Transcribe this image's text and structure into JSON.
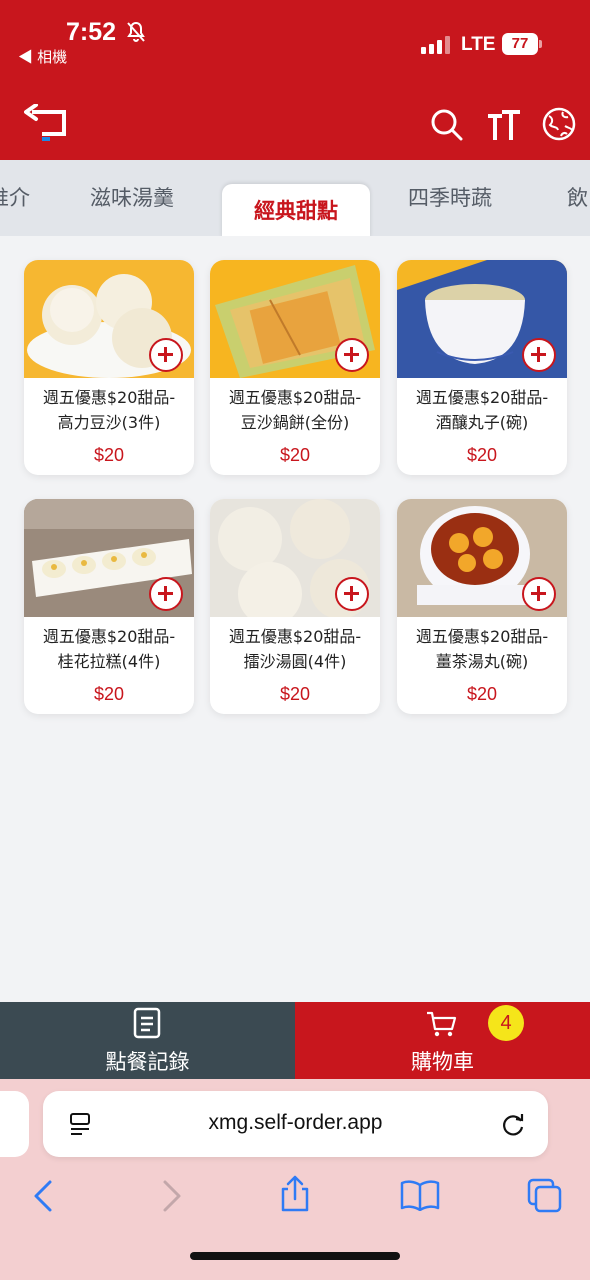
{
  "status": {
    "time": "7:52",
    "back_app": "◀ 相機",
    "network": "LTE",
    "battery": "77"
  },
  "tabs": [
    {
      "label": "推介"
    },
    {
      "label": "滋味湯羹"
    },
    {
      "label": "經典甜點",
      "active": true
    },
    {
      "label": "四季時蔬"
    },
    {
      "label": "飲"
    }
  ],
  "products": [
    {
      "name_line1": "週五優惠$20甜品-",
      "name_line2": "高力豆沙(3件)",
      "price": "$20"
    },
    {
      "name_line1": "週五優惠$20甜品-",
      "name_line2": "豆沙鍋餅(全份)",
      "price": "$20"
    },
    {
      "name_line1": "週五優惠$20甜品-",
      "name_line2": "酒釀丸子(碗)",
      "price": "$20"
    },
    {
      "name_line1": "週五優惠$20甜品-",
      "name_line2": "桂花拉糕(4件)",
      "price": "$20"
    },
    {
      "name_line1": "週五優惠$20甜品-",
      "name_line2": "擂沙湯圓(4件)",
      "price": "$20"
    },
    {
      "name_line1": "週五優惠$20甜品-",
      "name_line2": "薑茶湯丸(碗)",
      "price": "$20"
    }
  ],
  "bottom": {
    "orders_label": "點餐記錄",
    "cart_label": "購物車",
    "cart_count": "4"
  },
  "browser": {
    "url": "xmg.self-order.app"
  },
  "colors": {
    "brand_red": "#c8161d",
    "dark_slate": "#3b4a52",
    "badge_yellow": "#f5e51a"
  }
}
